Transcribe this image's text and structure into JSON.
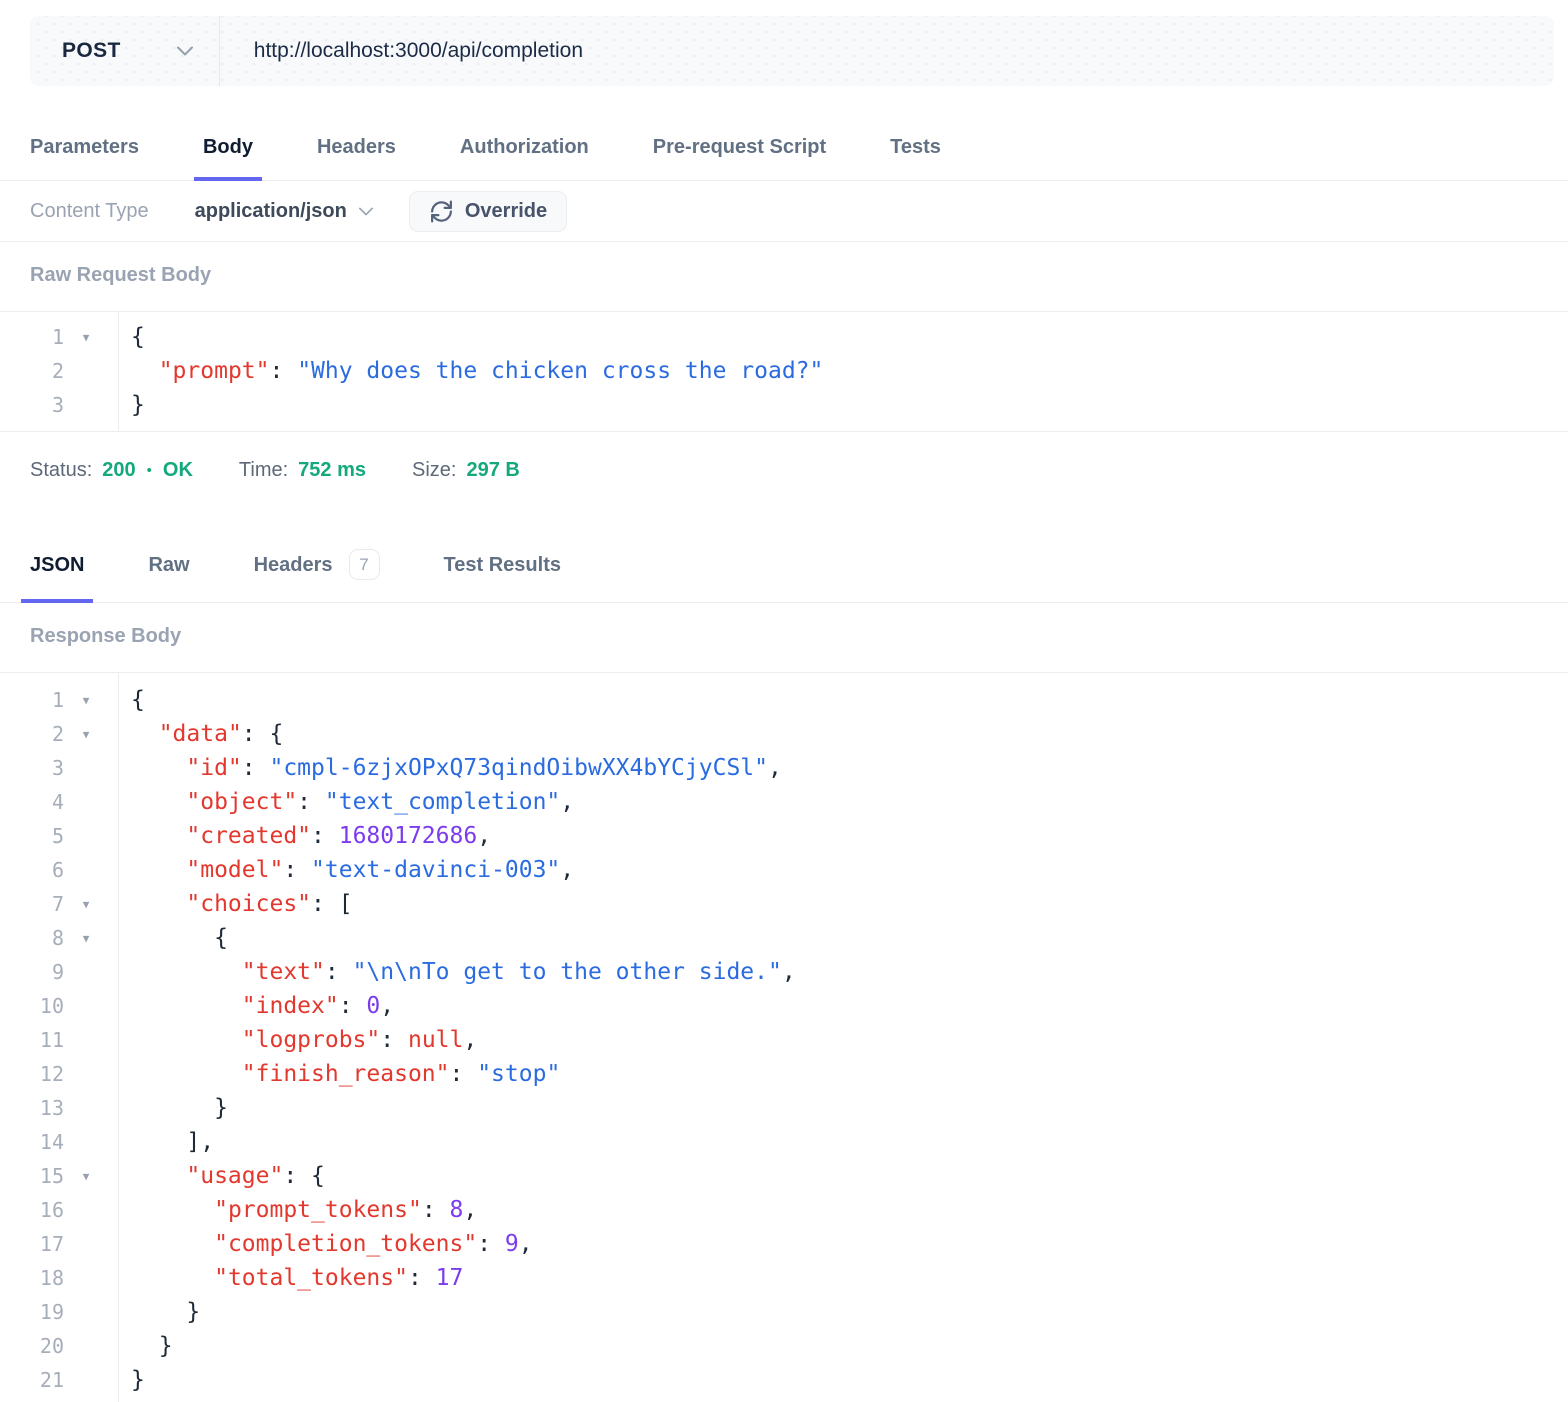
{
  "request_bar": {
    "method": "POST",
    "url": "http://localhost:3000/api/completion"
  },
  "request_tabs": [
    {
      "label": "Parameters",
      "active": false
    },
    {
      "label": "Body",
      "active": true
    },
    {
      "label": "Headers",
      "active": false
    },
    {
      "label": "Authorization",
      "active": false
    },
    {
      "label": "Pre-request Script",
      "active": false
    },
    {
      "label": "Tests",
      "active": false
    }
  ],
  "content_type": {
    "label": "Content Type",
    "value": "application/json",
    "override_label": "Override"
  },
  "request_editor": {
    "label": "Raw Request Body",
    "lines": [
      {
        "num": 1,
        "fold": true,
        "indent": 0,
        "tokens": [
          [
            "p",
            "{"
          ]
        ]
      },
      {
        "num": 2,
        "fold": false,
        "indent": 2,
        "tokens": [
          [
            "k",
            "\"prompt\""
          ],
          [
            "p",
            ": "
          ],
          [
            "s",
            "\"Why does the chicken cross the road?\""
          ]
        ]
      },
      {
        "num": 3,
        "fold": false,
        "indent": 0,
        "tokens": [
          [
            "p",
            "}"
          ]
        ]
      }
    ]
  },
  "status": {
    "status_label": "Status:",
    "code": "200",
    "separator": "•",
    "status_text": "OK",
    "time_label": "Time:",
    "time": "752 ms",
    "size_label": "Size:",
    "size": "297 B"
  },
  "response_tabs": [
    {
      "label": "JSON",
      "active": true
    },
    {
      "label": "Raw",
      "active": false
    },
    {
      "label": "Headers",
      "active": false,
      "badge": "7"
    },
    {
      "label": "Test Results",
      "active": false
    }
  ],
  "response_editor": {
    "label": "Response Body",
    "lines": [
      {
        "num": 1,
        "fold": true,
        "indent": 0,
        "tokens": [
          [
            "p",
            "{"
          ]
        ]
      },
      {
        "num": 2,
        "fold": true,
        "indent": 2,
        "tokens": [
          [
            "k",
            "\"data\""
          ],
          [
            "p",
            ": {"
          ]
        ]
      },
      {
        "num": 3,
        "fold": false,
        "indent": 4,
        "tokens": [
          [
            "k",
            "\"id\""
          ],
          [
            "p",
            ": "
          ],
          [
            "s",
            "\"cmpl-6zjxOPxQ73qindOibwXX4bYCjyCSl\""
          ],
          [
            "p",
            ","
          ]
        ]
      },
      {
        "num": 4,
        "fold": false,
        "indent": 4,
        "tokens": [
          [
            "k",
            "\"object\""
          ],
          [
            "p",
            ": "
          ],
          [
            "s",
            "\"text_completion\""
          ],
          [
            "p",
            ","
          ]
        ]
      },
      {
        "num": 5,
        "fold": false,
        "indent": 4,
        "tokens": [
          [
            "k",
            "\"created\""
          ],
          [
            "p",
            ": "
          ],
          [
            "n",
            "1680172686"
          ],
          [
            "p",
            ","
          ]
        ]
      },
      {
        "num": 6,
        "fold": false,
        "indent": 4,
        "tokens": [
          [
            "k",
            "\"model\""
          ],
          [
            "p",
            ": "
          ],
          [
            "s",
            "\"text-davinci-003\""
          ],
          [
            "p",
            ","
          ]
        ]
      },
      {
        "num": 7,
        "fold": true,
        "indent": 4,
        "tokens": [
          [
            "k",
            "\"choices\""
          ],
          [
            "p",
            ": ["
          ]
        ]
      },
      {
        "num": 8,
        "fold": true,
        "indent": 6,
        "tokens": [
          [
            "p",
            "{"
          ]
        ]
      },
      {
        "num": 9,
        "fold": false,
        "indent": 8,
        "tokens": [
          [
            "k",
            "\"text\""
          ],
          [
            "p",
            ": "
          ],
          [
            "s",
            "\"\\n\\nTo get to the other side.\""
          ],
          [
            "p",
            ","
          ]
        ]
      },
      {
        "num": 10,
        "fold": false,
        "indent": 8,
        "tokens": [
          [
            "k",
            "\"index\""
          ],
          [
            "p",
            ": "
          ],
          [
            "n",
            "0"
          ],
          [
            "p",
            ","
          ]
        ]
      },
      {
        "num": 11,
        "fold": false,
        "indent": 8,
        "tokens": [
          [
            "k",
            "\"logprobs\""
          ],
          [
            "p",
            ": "
          ],
          [
            "x",
            "null"
          ],
          [
            "p",
            ","
          ]
        ]
      },
      {
        "num": 12,
        "fold": false,
        "indent": 8,
        "tokens": [
          [
            "k",
            "\"finish_reason\""
          ],
          [
            "p",
            ": "
          ],
          [
            "s",
            "\"stop\""
          ]
        ]
      },
      {
        "num": 13,
        "fold": false,
        "indent": 6,
        "tokens": [
          [
            "p",
            "}"
          ]
        ]
      },
      {
        "num": 14,
        "fold": false,
        "indent": 4,
        "tokens": [
          [
            "p",
            "],"
          ]
        ]
      },
      {
        "num": 15,
        "fold": true,
        "indent": 4,
        "tokens": [
          [
            "k",
            "\"usage\""
          ],
          [
            "p",
            ": {"
          ]
        ]
      },
      {
        "num": 16,
        "fold": false,
        "indent": 6,
        "tokens": [
          [
            "k",
            "\"prompt_tokens\""
          ],
          [
            "p",
            ": "
          ],
          [
            "n",
            "8"
          ],
          [
            "p",
            ","
          ]
        ]
      },
      {
        "num": 17,
        "fold": false,
        "indent": 6,
        "tokens": [
          [
            "k",
            "\"completion_tokens\""
          ],
          [
            "p",
            ": "
          ],
          [
            "n",
            "9"
          ],
          [
            "p",
            ","
          ]
        ]
      },
      {
        "num": 18,
        "fold": false,
        "indent": 6,
        "tokens": [
          [
            "k",
            "\"total_tokens\""
          ],
          [
            "p",
            ": "
          ],
          [
            "n",
            "17"
          ]
        ]
      },
      {
        "num": 19,
        "fold": false,
        "indent": 4,
        "tokens": [
          [
            "p",
            "}"
          ]
        ]
      },
      {
        "num": 20,
        "fold": false,
        "indent": 2,
        "tokens": [
          [
            "p",
            "}"
          ]
        ]
      },
      {
        "num": 21,
        "fold": false,
        "indent": 0,
        "tokens": [
          [
            "p",
            "}"
          ]
        ]
      }
    ]
  },
  "colors": {
    "accent_indigo": "#6366f1",
    "status_green": "#14a87d",
    "json_key_red": "#e2382e",
    "json_string_blue": "#2b6be0",
    "json_number_purple": "#7c3bed",
    "bar_background": "#f8f9fb"
  }
}
